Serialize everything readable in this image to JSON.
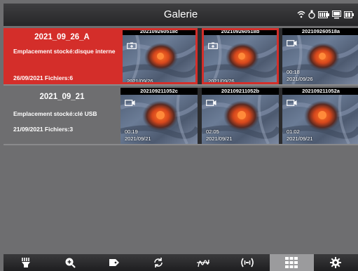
{
  "header": {
    "title": "Galerie"
  },
  "status_icons": [
    "wifi-icon",
    "battery-icon",
    "camera-battery-icon",
    "storage-icon",
    "screen-battery-icon"
  ],
  "albums": [
    {
      "name": "2021_09_26_A",
      "location": "Emplacement stocké:disque interne",
      "date_files": "26/09/2021 Fichiers:6",
      "selected": true,
      "thumbs": [
        {
          "file": "202109260518c",
          "type": "photo",
          "duration": "",
          "date": "2021/09/26",
          "selected": true
        },
        {
          "file": "202109260518b",
          "type": "photo",
          "duration": "",
          "date": "2021/09/26",
          "selected": true
        },
        {
          "file": "202109260518a",
          "type": "video",
          "duration": "00:18",
          "date": "2021/09/26",
          "selected": false
        }
      ]
    },
    {
      "name": "2021_09_21",
      "location": "Emplacement stocké:clé USB",
      "date_files": "21/09/2021 Fichiers:3",
      "selected": false,
      "thumbs": [
        {
          "file": "202109211052c",
          "type": "video",
          "duration": "00:19",
          "date": "2021/09/21",
          "selected": false
        },
        {
          "file": "202109211052b",
          "type": "video",
          "duration": "02:05",
          "date": "2021/09/21",
          "selected": false
        },
        {
          "file": "202109211052a",
          "type": "video",
          "duration": "01:02",
          "date": "2021/09/21",
          "selected": false
        }
      ]
    }
  ],
  "toolbar": [
    "light-icon",
    "zoom-in-icon",
    "tag-icon",
    "rotate-icon",
    "wave-filter-icon",
    "signal-icon",
    "gallery-grid-icon",
    "settings-gear-icon"
  ],
  "toolbar_active": "gallery-grid-icon",
  "colors": {
    "accent": "#d42e2a",
    "background": "#6e6e70"
  }
}
